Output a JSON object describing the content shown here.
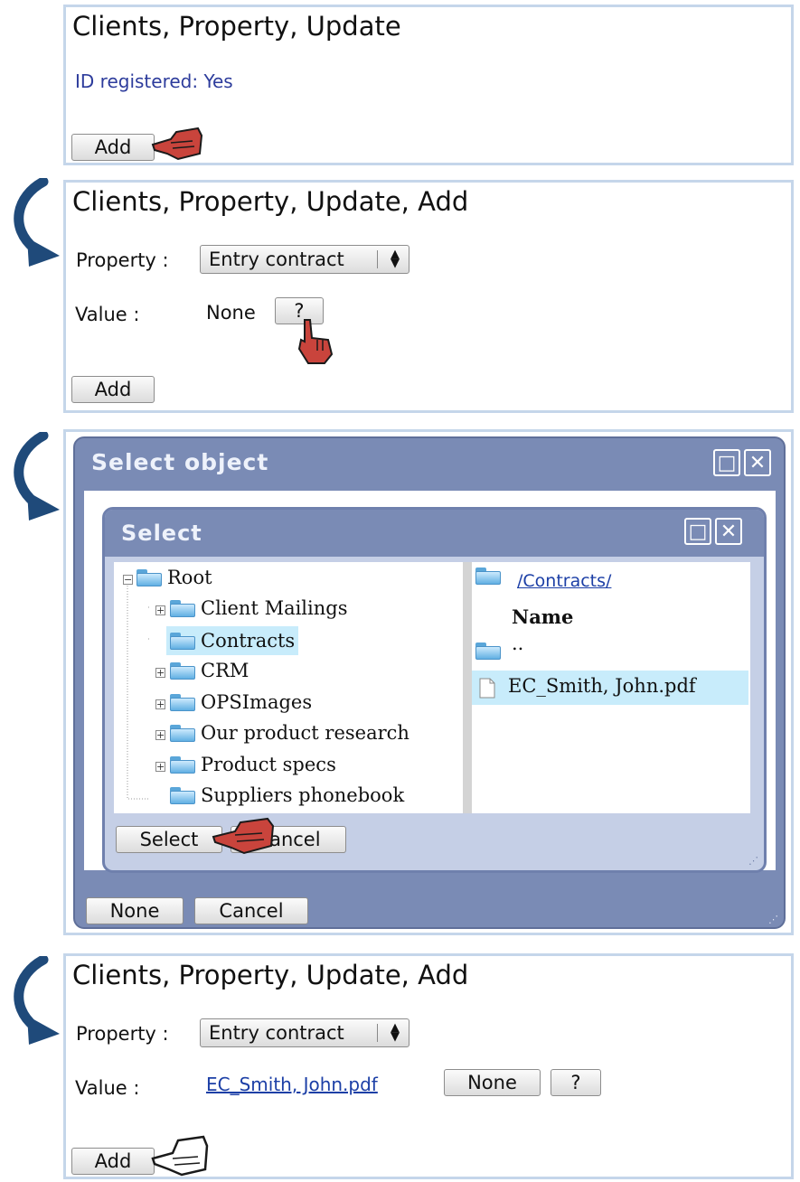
{
  "panel1": {
    "title": "Clients, Property, Update",
    "id_registered": "ID registered: Yes",
    "add_label": "Add"
  },
  "panel2": {
    "title": "Clients, Property, Update, Add",
    "property_label": "Property :",
    "property_value": "Entry contract",
    "value_label": "Value :",
    "value_text": "None",
    "help_label": "?",
    "add_label": "Add"
  },
  "dialog": {
    "title": "Select object",
    "inner_title": "Select",
    "tree": [
      "Root",
      "Client Mailings",
      "Contracts",
      "CRM",
      "OPSImages",
      "Our product research",
      "Product specs",
      "Suppliers phonebook"
    ],
    "current_path": "/Contracts/",
    "name_header": "Name",
    "parent_dir": "..",
    "file": "EC_Smith, John.pdf",
    "select_label": "Select",
    "inner_cancel_label": "Cancel",
    "none_label": "None",
    "cancel_label": "Cancel"
  },
  "panel4": {
    "title": "Clients, Property, Update, Add",
    "property_label": "Property :",
    "property_value": "Entry contract",
    "value_label": "Value :",
    "value_link": "EC_Smith, John.pdf",
    "none_label": "None",
    "help_label": "?",
    "add_label": "Add"
  },
  "colors": {
    "panel_border": "#c5d6ea",
    "dialog_header": "#7a8bb5",
    "link": "#1c3fa6",
    "selection": "#c8ecfb",
    "arrow": "#1f4a7a",
    "hand": "#c9443c"
  },
  "icons": [
    "curved-arrow-icon",
    "pointing-hand-icon",
    "folder-icon",
    "file-icon",
    "maximize-icon",
    "close-icon",
    "resize-grip-icon"
  ]
}
